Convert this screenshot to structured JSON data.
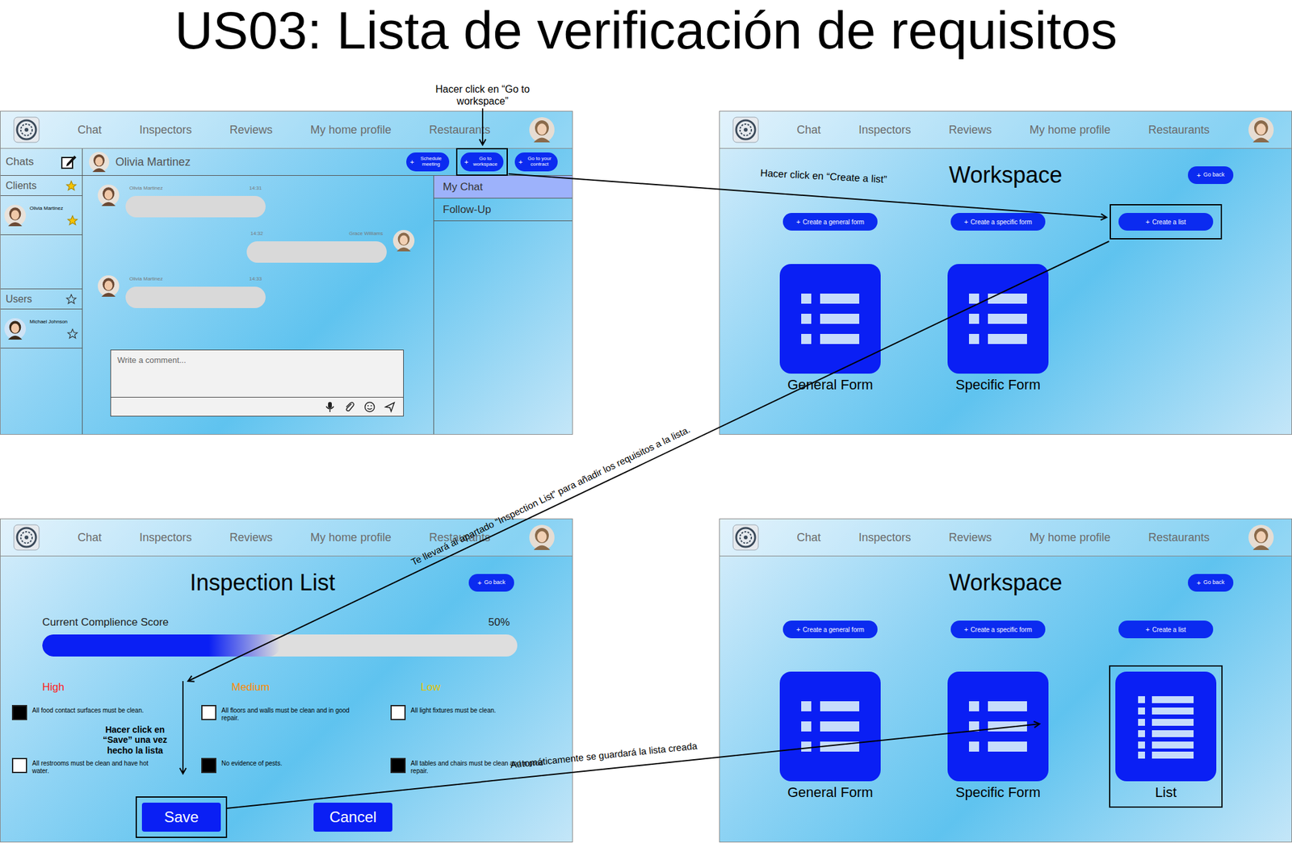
{
  "title": "US03: Lista de verificación de requisitos",
  "nav": [
    "Chat",
    "Inspectors",
    "Reviews",
    "My home profile",
    "Restaurants"
  ],
  "chat_screen": {
    "sidebar": {
      "header": "Chats",
      "sections": [
        {
          "label": "Clients",
          "starred": true,
          "people": [
            {
              "name": "Olivia Martinez",
              "starred": true
            }
          ]
        },
        {
          "label": "Users",
          "starred": false,
          "people": [
            {
              "name": "Michael Johnson",
              "starred": false
            }
          ]
        }
      ]
    },
    "contact": "Olivia Martinez",
    "actions": [
      {
        "icon": "+",
        "label": "Schedule meeting",
        "highlighted": false
      },
      {
        "icon": "+",
        "label": "Go to workspace",
        "highlighted": true
      },
      {
        "icon": "+",
        "label": "Go to your contract",
        "highlighted": false
      }
    ],
    "messages": [
      {
        "author": "Olivia Martinez",
        "time": "14:31",
        "kind": "incoming"
      },
      {
        "author": "Grace Williams",
        "time": "14:32",
        "kind": "outgoing"
      },
      {
        "author": "Olivia Martinez",
        "time": "14:33",
        "kind": "incoming"
      }
    ],
    "comment": {
      "placeholder": "Write a comment..."
    },
    "menu": [
      {
        "label": "My Chat",
        "selected": true
      },
      {
        "label": "Follow-Up",
        "selected": false
      }
    ]
  },
  "workspace_screen": {
    "title": "Workspace",
    "back_icon": "+",
    "back": "Go back",
    "items": [
      {
        "icon": "+",
        "button": "Create a general form",
        "highlighted": false,
        "card": "General Form",
        "kind": "form",
        "card_highlighted": false
      },
      {
        "icon": "+",
        "button": "Create a specific form",
        "highlighted": false,
        "card": "Specific Form",
        "kind": "form",
        "card_highlighted": false
      },
      {
        "icon": "+",
        "button": "Create a list",
        "highlighted": true
      }
    ]
  },
  "inspection_screen": {
    "title": "Inspection List",
    "back_icon": "+",
    "back": "Go back",
    "score": {
      "label": "Current Complience Score",
      "reading": "50%",
      "level": 0.5
    },
    "columns": [
      {
        "label": "High",
        "color": "#ff1a1a",
        "items": [
          {
            "text": "All food contact surfaces must be clean.",
            "checked": true
          },
          {
            "text": "All restrooms must be clean and have hot water.",
            "checked": false
          }
        ]
      },
      {
        "label": "Medium",
        "color": "#ff8a00",
        "items": [
          {
            "text": "All floors and walls must be clean and in good repair.",
            "checked": false
          },
          {
            "text": "No evidence of pests.",
            "checked": true
          }
        ]
      },
      {
        "label": "Low",
        "color": "#e0c400",
        "items": [
          {
            "text": "All light fixtures must be clean.",
            "checked": false
          },
          {
            "text": "All tables and chairs must be clean and in good repair.",
            "checked": true
          }
        ]
      }
    ],
    "buttons": [
      {
        "label": "Save",
        "highlighted": true
      },
      {
        "label": "Cancel",
        "highlighted": false
      }
    ]
  },
  "saved_workspace_screen": {
    "title": "Workspace",
    "back_icon": "+",
    "back": "Go back",
    "items": [
      {
        "icon": "+",
        "button": "Create a general form",
        "highlighted": false,
        "card": "General Form",
        "kind": "form",
        "card_highlighted": false
      },
      {
        "icon": "+",
        "button": "Create a specific form",
        "highlighted": false,
        "card": "Specific Form",
        "kind": "form",
        "card_highlighted": false
      },
      {
        "icon": "+",
        "button": "Create a list",
        "highlighted": false,
        "card": "List",
        "kind": "list",
        "card_highlighted": true
      }
    ]
  },
  "annotations": {
    "go_to_workspace": "Hacer click en “Go to workspace”",
    "create_list": "Hacer click en “Create a list”",
    "inspection": "Te llevará al apartado “Inspection List” para añadir los requisitos a la lista.",
    "save": "Hacer click en “Save” una vez hecho la lista",
    "autosave": "Automáticamente se guardará la lista creada"
  }
}
